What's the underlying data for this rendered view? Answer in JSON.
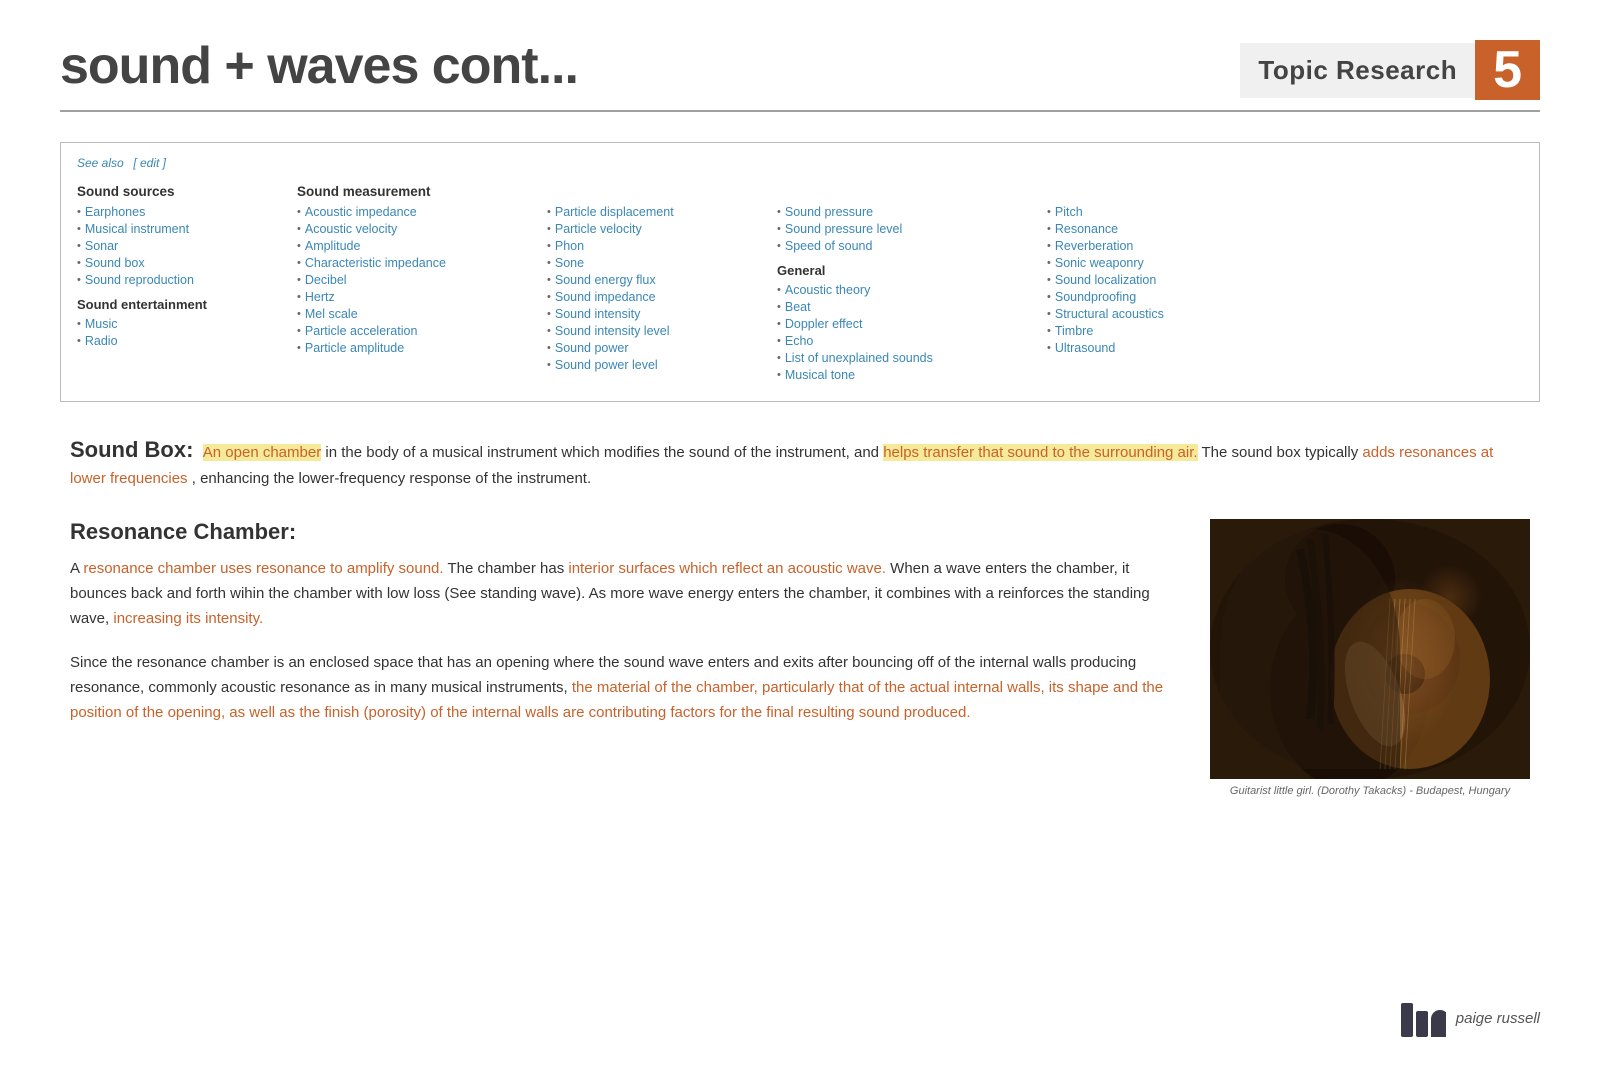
{
  "header": {
    "title": "sound + waves cont...",
    "badge_text": "Topic Research",
    "badge_number": "5"
  },
  "see_also": {
    "label": "See also",
    "edit_label": "[ edit ]",
    "columns": [
      {
        "header": "Sound sources",
        "items": [
          "Earphones",
          "Musical instrument",
          "Sonar",
          "Sound box",
          "Sound reproduction"
        ],
        "subheader": "Sound entertainment",
        "sub_items": [
          "Music",
          "Radio"
        ]
      },
      {
        "header": "Sound measurement",
        "items": [
          "Acoustic impedance",
          "Acoustic velocity",
          "Amplitude",
          "Characteristic impedance",
          "Decibel",
          "Hertz",
          "Mel scale",
          "Particle acceleration",
          "Particle amplitude"
        ]
      },
      {
        "header": null,
        "items": [
          "Particle displacement",
          "Particle velocity",
          "Phon",
          "Sone",
          "Sound energy flux",
          "Sound impedance",
          "Sound intensity",
          "Sound intensity level",
          "Sound power",
          "Sound power level"
        ]
      },
      {
        "header": null,
        "top_items": [
          "Sound pressure",
          "Sound pressure level",
          "Speed of sound"
        ],
        "subheader": "General",
        "items": [
          "Acoustic theory",
          "Beat",
          "Doppler effect",
          "Echo",
          "List of unexplained sounds",
          "Musical tone"
        ]
      },
      {
        "header": null,
        "top_items": [
          "Pitch",
          "Resonance",
          "Reverberation",
          "Sonic weaponry",
          "Sound localization",
          "Soundproofing",
          "Structural acoustics",
          "Timbre",
          "Ultrasound"
        ]
      }
    ]
  },
  "sound_box": {
    "title": "Sound Box:",
    "text_plain1": " in the body of a musical instrument which modifies the sound of the instrument, and ",
    "text_highlight1": "An open chamber",
    "text_highlight2": "helps transfer that sound to the surrounding air.",
    "text_plain2": " The sound box typically ",
    "text_highlight3": "adds resonances at lower frequencies",
    "text_plain3": ", enhancing the lower-frequency response of the instrument."
  },
  "resonance_chamber": {
    "title": "Resonance Chamber:",
    "paragraph1_parts": [
      {
        "text": "A ",
        "highlight": false
      },
      {
        "text": "resonance chamber uses resonance to amplify sound.",
        "highlight": true
      },
      {
        "text": " The chamber has ",
        "highlight": false
      },
      {
        "text": "interior surfaces which reflect an acoustic wave.",
        "highlight": true
      },
      {
        "text": " When a wave enters the chamber, it bounces back and forth wihin the chamber with low loss (See standing wave). As more wave energy enters the chamber, it combines with a reinforces the standing wave, ",
        "highlight": false
      },
      {
        "text": "increasing its intensity.",
        "highlight": true
      }
    ],
    "paragraph2_parts": [
      {
        "text": "Since the resonance chamber is an enclosed space that has an opening where the sound wave enters and exits after bouncing off of the internal walls producing resonance, commonly acoustic resonance as in many musical instruments, ",
        "highlight": false
      },
      {
        "text": "the material of the chamber, particularly that of the actual internal walls, its shape and the position of the opening, as well as the finish (porosity) of the internal walls are contributing factors for the final resulting sound produced.",
        "highlight": true
      }
    ],
    "image_caption": "Guitarist little girl. (Dorothy Takacks) - Budapest, Hungary"
  },
  "footer": {
    "name": "paige russell"
  }
}
